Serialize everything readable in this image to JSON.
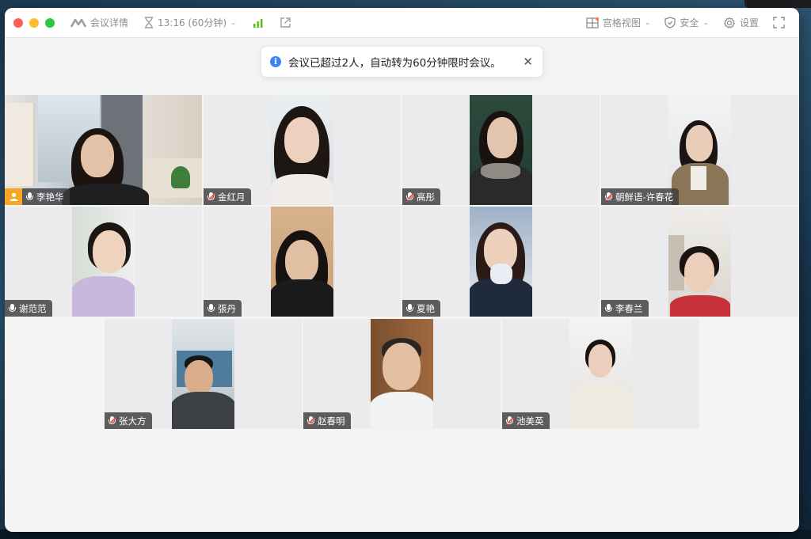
{
  "titlebar": {
    "meeting_details": "会议详情",
    "timer": "13:16 (60分钟)",
    "grid_view": "宫格视图",
    "security": "安全",
    "settings": "设置"
  },
  "toast": {
    "message": "会议已超过2人，自动转为60分钟限时会议。"
  },
  "participants": [
    {
      "name": "李艳华",
      "host": true,
      "mic": "on"
    },
    {
      "name": "金红月",
      "mic": "muted"
    },
    {
      "name": "高彤",
      "mic": "muted"
    },
    {
      "name": "朝鲜语-许春花",
      "mic": "muted"
    },
    {
      "name": "谢范范",
      "mic": "on"
    },
    {
      "name": "張丹",
      "mic": "on"
    },
    {
      "name": "夏艳",
      "mic": "on"
    },
    {
      "name": "李春兰",
      "mic": "on"
    },
    {
      "name": "张大方",
      "mic": "muted"
    },
    {
      "name": "赵春明",
      "mic": "muted"
    },
    {
      "name": "池美英",
      "mic": "muted"
    }
  ],
  "colors": {
    "host_badge": "#f5a623",
    "muted_slash": "#ff4d4f",
    "info_icon": "#3a86f7"
  }
}
